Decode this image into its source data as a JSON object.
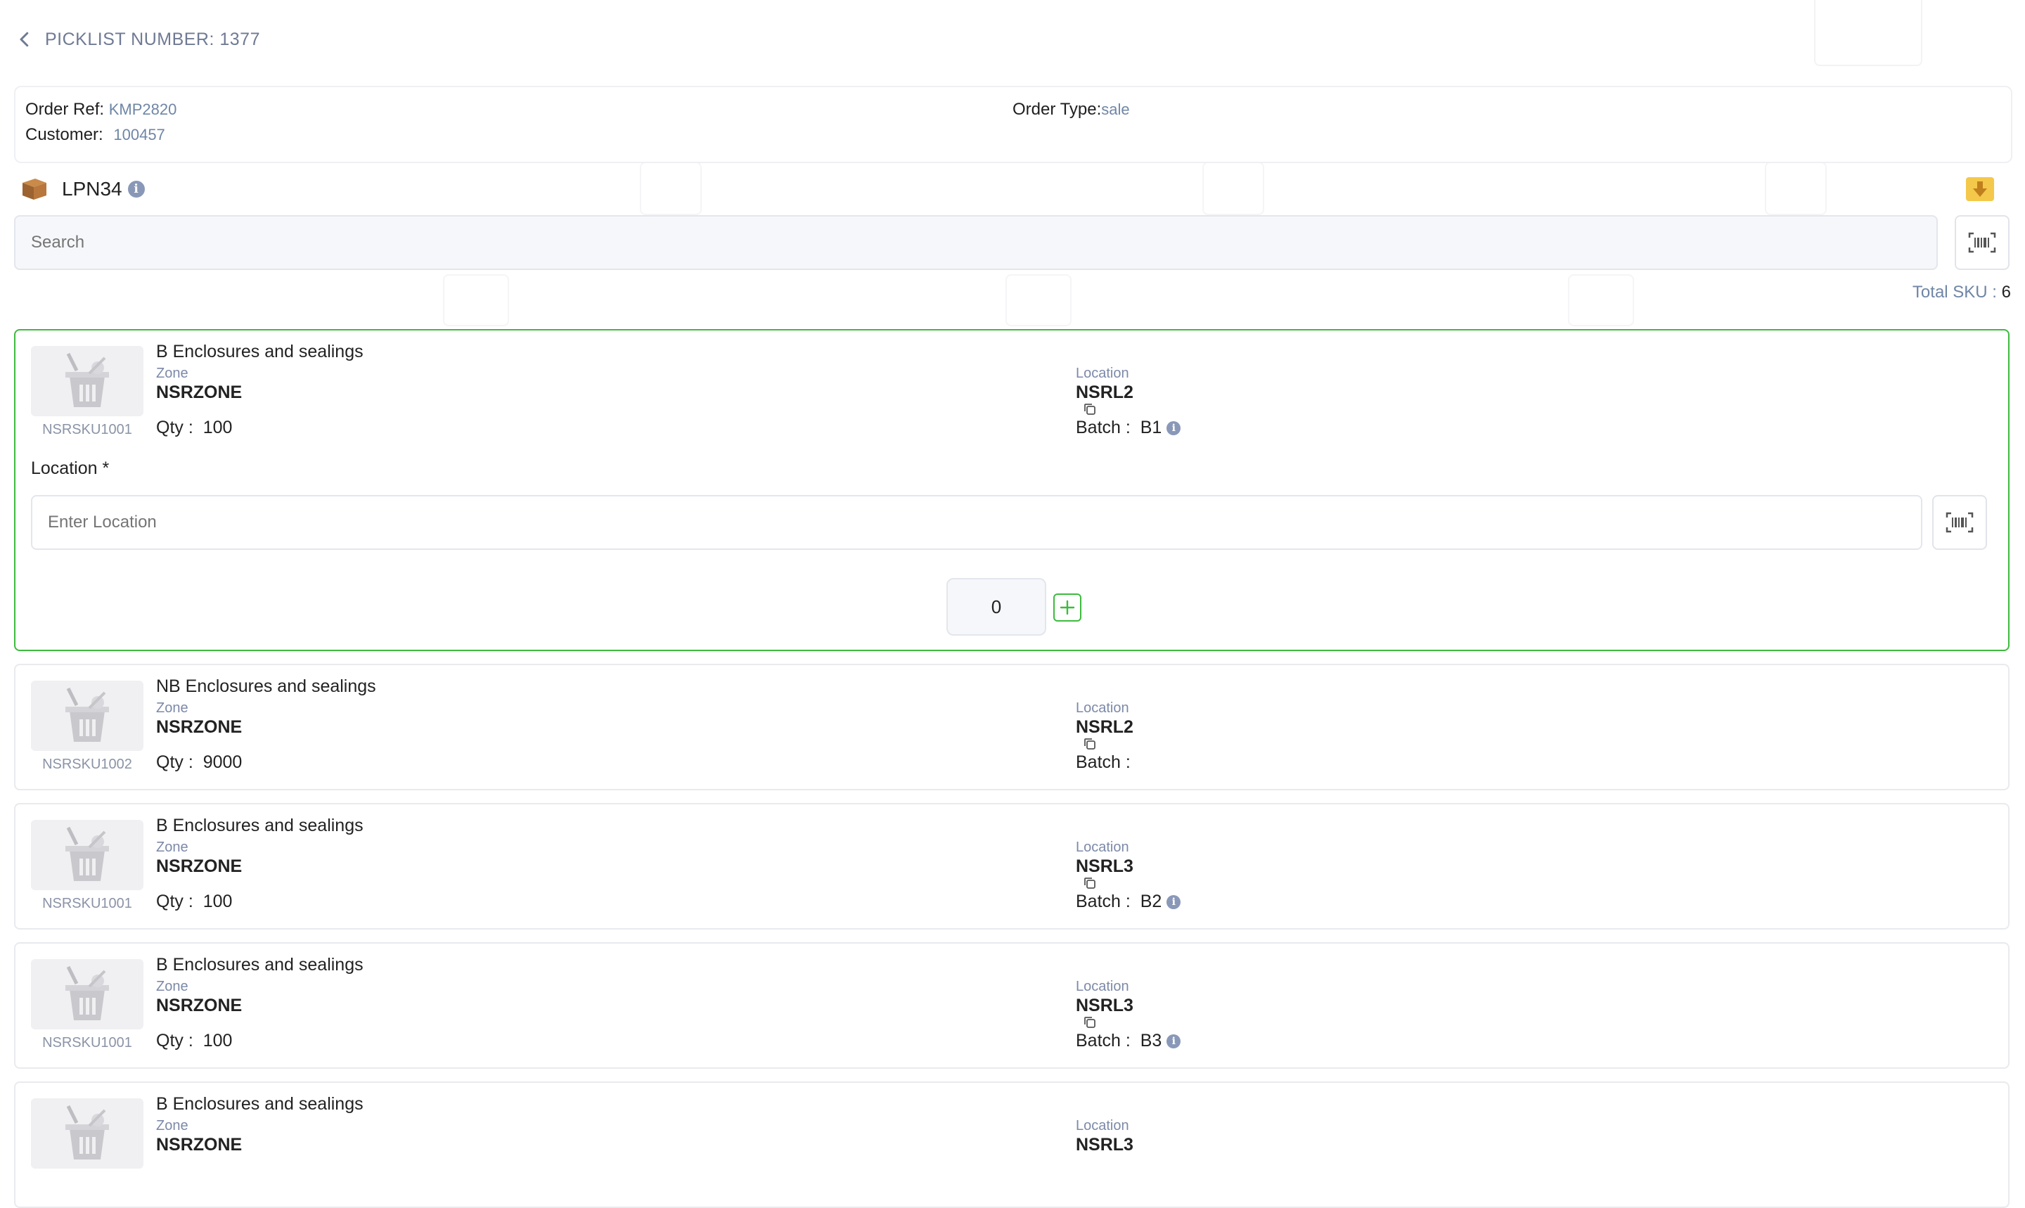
{
  "header": {
    "title": "PICKLIST NUMBER: 1377"
  },
  "order": {
    "ref_label": "Order Ref:",
    "ref_value": "KMP2820",
    "customer_label": "Customer:",
    "customer_value": "100457",
    "type_label": "Order Type:",
    "type_value": "sale"
  },
  "lpn": {
    "label": "LPN34",
    "info": "i"
  },
  "search": {
    "placeholder": "Search"
  },
  "total_sku": {
    "label": "Total SKU :",
    "value": "6"
  },
  "items": [
    {
      "title": "B Enclosures and sealings",
      "sku": "NSRSKU1001",
      "zone_label": "Zone",
      "zone": "NSRZONE",
      "qty_label": "Qty :",
      "qty": "100",
      "location_label": "Location",
      "location": "NSRL2",
      "batch_label": "Batch :",
      "batch": "B1",
      "batch_info": "i"
    },
    {
      "title": "NB Enclosures and sealings",
      "sku": "NSRSKU1002",
      "zone_label": "Zone",
      "zone": "NSRZONE",
      "qty_label": "Qty :",
      "qty": "9000",
      "location_label": "Location",
      "location": "NSRL2",
      "batch_label": "Batch :",
      "batch": ""
    },
    {
      "title": "B Enclosures and sealings",
      "sku": "NSRSKU1001",
      "zone_label": "Zone",
      "zone": "NSRZONE",
      "qty_label": "Qty :",
      "qty": "100",
      "location_label": "Location",
      "location": "NSRL3",
      "batch_label": "Batch :",
      "batch": "B2",
      "batch_info": "i"
    },
    {
      "title": "B Enclosures and sealings",
      "sku": "NSRSKU1001",
      "zone_label": "Zone",
      "zone": "NSRZONE",
      "qty_label": "Qty :",
      "qty": "100",
      "location_label": "Location",
      "location": "NSRL3",
      "batch_label": "Batch :",
      "batch": "B3",
      "batch_info": "i"
    },
    {
      "title": "B Enclosures and sealings",
      "zone_label": "Zone",
      "zone": "NSRZONE",
      "location_label": "Location",
      "location": "NSRL3"
    }
  ],
  "active_item": {
    "location_field_label": "Location *",
    "location_placeholder": "Enter Location",
    "pick_qty": "0"
  },
  "colors": {
    "accent_green": "#3dbb3d",
    "label_blue": "#6f86a6",
    "download_yellow": "#f4c84a"
  }
}
